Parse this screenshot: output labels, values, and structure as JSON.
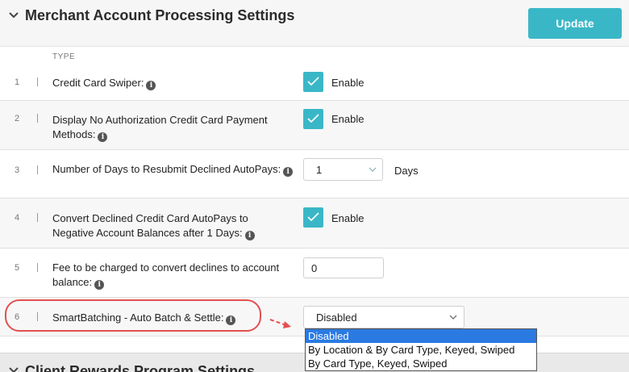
{
  "header": {
    "title": "Merchant Account Processing Settings",
    "update_label": "Update"
  },
  "table": {
    "column_header": "TYPE",
    "rows": [
      {
        "num": "1",
        "label": "Credit Card Swiper:",
        "control": "checkbox",
        "checked": true,
        "control_label": "Enable"
      },
      {
        "num": "2",
        "label": "Display No Authorization Credit Card Payment Methods:",
        "control": "checkbox",
        "checked": true,
        "control_label": "Enable"
      },
      {
        "num": "3",
        "label": "Number of Days to Resubmit Declined AutoPays:",
        "control": "select",
        "value": "1",
        "suffix": "Days"
      },
      {
        "num": "4",
        "label": "Convert Declined Credit Card AutoPays to Negative Account Balances after 1 Days:",
        "control": "checkbox",
        "checked": true,
        "control_label": "Enable"
      },
      {
        "num": "5",
        "label": "Fee to be charged to convert declines to account balance:",
        "control": "text",
        "value": "0"
      },
      {
        "num": "6",
        "label": "SmartBatching - Auto Batch & Settle:",
        "control": "select",
        "value": "Disabled"
      }
    ]
  },
  "smartbatching_dropdown": {
    "options": [
      "Disabled",
      "By Location & By Card Type, Keyed, Swiped",
      "By Card Type, Keyed, Swiped"
    ],
    "selected": "Disabled"
  },
  "footer": {
    "title": "Client Rewards Program Settings"
  },
  "colors": {
    "accent": "#3ab7c7",
    "highlight": "#e35050",
    "dropdown_selected": "#2a7ae2"
  }
}
